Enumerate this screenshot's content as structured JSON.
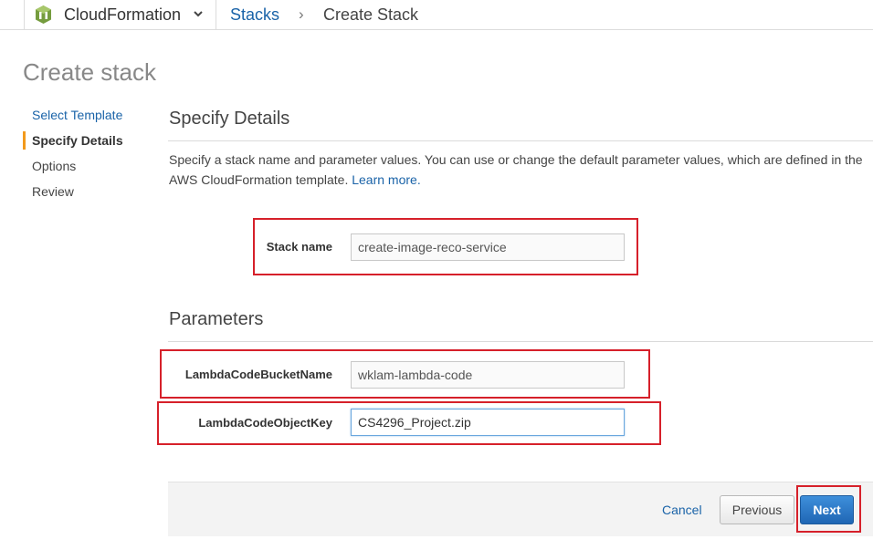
{
  "header": {
    "service_name": "CloudFormation",
    "breadcrumb": {
      "stacks": "Stacks",
      "separator": "›",
      "current": "Create Stack"
    }
  },
  "page": {
    "title": "Create stack"
  },
  "steps": [
    {
      "label": "Select Template",
      "state": "link"
    },
    {
      "label": "Specify Details",
      "state": "active"
    },
    {
      "label": "Options",
      "state": "pending"
    },
    {
      "label": "Review",
      "state": "pending"
    }
  ],
  "details": {
    "title": "Specify Details",
    "description": "Specify a stack name and parameter values. You can use or change the default parameter values, which are defined in the AWS CloudFormation template.",
    "learn_more": "Learn more."
  },
  "stack_name": {
    "label": "Stack name",
    "value": "create-image-reco-service"
  },
  "parameters": {
    "title": "Parameters",
    "fields": [
      {
        "label": "LambdaCodeBucketName",
        "value": "wklam-lambda-code"
      },
      {
        "label": "LambdaCodeObjectKey",
        "value": "CS4296_Project.zip"
      }
    ]
  },
  "footer": {
    "cancel": "Cancel",
    "previous": "Previous",
    "next": "Next"
  },
  "colors": {
    "link": "#1a63a8",
    "active_step_marker": "#f29a1c",
    "highlight_box": "#d6202a",
    "primary_button": "#1f66b4"
  },
  "icons": {
    "service": "cloudformation-icon",
    "caret": "chevron-down-icon"
  }
}
